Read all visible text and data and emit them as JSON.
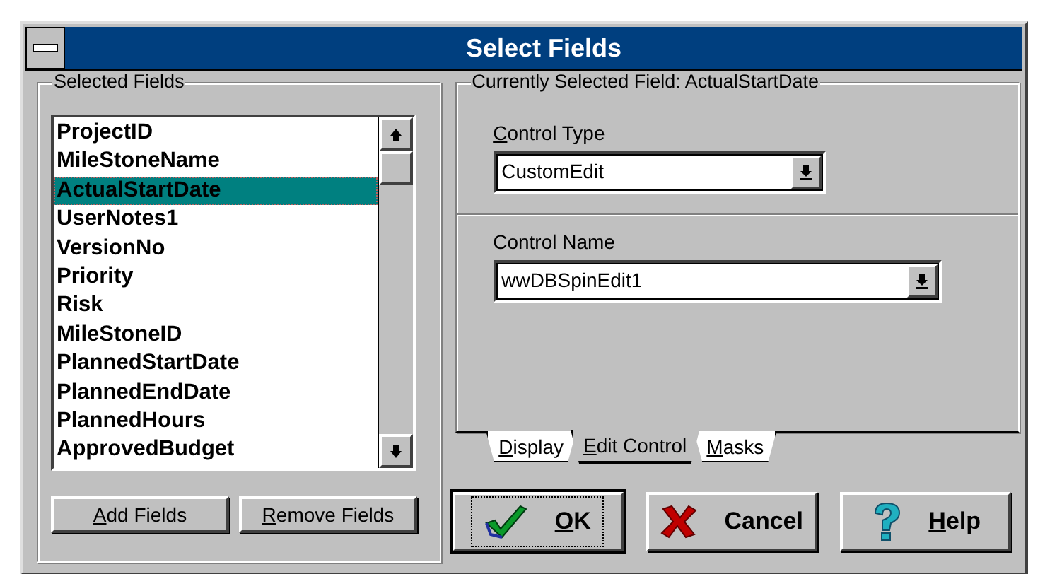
{
  "window": {
    "title": "Select Fields"
  },
  "selected_fields": {
    "label": "Selected Fields",
    "items": [
      {
        "text": "ProjectID",
        "selected": false
      },
      {
        "text": "MileStoneName",
        "selected": false
      },
      {
        "text": "ActualStartDate",
        "selected": true
      },
      {
        "text": "UserNotes1",
        "selected": false
      },
      {
        "text": "VersionNo",
        "selected": false
      },
      {
        "text": "Priority",
        "selected": false
      },
      {
        "text": "Risk",
        "selected": false
      },
      {
        "text": "MileStoneID",
        "selected": false
      },
      {
        "text": "PlannedStartDate",
        "selected": false
      },
      {
        "text": "PlannedEndDate",
        "selected": false
      },
      {
        "text": "PlannedHours",
        "selected": false
      },
      {
        "text": "ApprovedBudget",
        "selected": false
      }
    ]
  },
  "left_buttons": [
    {
      "label": "Add Fields",
      "mnemonic": true
    },
    {
      "label": "Remove Fields",
      "mnemonic": true
    }
  ],
  "field_panel": {
    "label": "Currently Selected Field: ActualStartDate",
    "controls": [
      {
        "label": "Control Type",
        "mnemonic": true,
        "value": "CustomEdit"
      },
      {
        "label": "Control Name",
        "mnemonic": false,
        "value": "wwDBSpinEdit1"
      }
    ]
  },
  "tabs": [
    {
      "label": "Display",
      "mnemonic": true,
      "selected": false
    },
    {
      "label": "Edit Control",
      "mnemonic": true,
      "selected": true
    },
    {
      "label": "Masks",
      "mnemonic": true,
      "selected": false
    }
  ],
  "buttons": [
    {
      "label": "OK",
      "kind": "check",
      "mnemonic": true,
      "default": true
    },
    {
      "label": "Cancel",
      "kind": "cross",
      "mnemonic": false,
      "default": false
    },
    {
      "label": "Help",
      "kind": "question",
      "mnemonic": true,
      "default": false
    }
  ]
}
